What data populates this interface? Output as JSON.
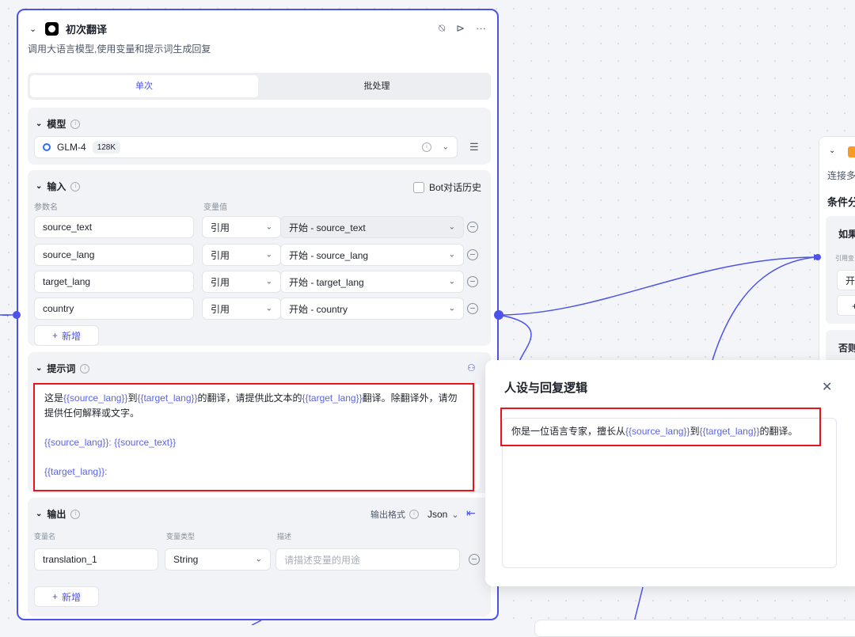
{
  "node": {
    "title": "初次翻译",
    "description": "调用大语言模型,使用变量和提示词生成回复",
    "tabs": {
      "single": "单次",
      "batch": "批处理"
    },
    "model": {
      "section_label": "模型",
      "name": "GLM-4",
      "context_badge": "128K"
    },
    "input": {
      "section_label": "输入",
      "bot_history_label": "Bot对话历史",
      "param_name_header": "参数名",
      "var_value_header": "变量值",
      "rows": [
        {
          "name": "source_text",
          "mode": "引用",
          "value": "开始 - source_text"
        },
        {
          "name": "source_lang",
          "mode": "引用",
          "value": "开始 - source_lang"
        },
        {
          "name": "target_lang",
          "mode": "引用",
          "value": "开始 - target_lang"
        },
        {
          "name": "country",
          "mode": "引用",
          "value": "开始 - country"
        }
      ],
      "add_label": "新增"
    },
    "prompt": {
      "section_label": "提示词",
      "line1_a": "这是",
      "line1_var1": "{{source_lang}}",
      "line1_b": "到",
      "line1_var2": "{{target_lang}}",
      "line1_c": "的翻译，请提供此文本的",
      "line1_var3": "{{target_lang}}",
      "line1_d": "翻译。除翻译外，请勿",
      "line2": "提供任何解释或文字。",
      "line3_var1": "{{source_lang}}",
      "line3_sep": ": ",
      "line3_var2": "{{source_text}}",
      "line4_var": "{{target_lang}}",
      "line4_sep": ":"
    },
    "output": {
      "section_label": "输出",
      "format_label": "输出格式",
      "format_value": "Json",
      "var_name_header": "变量名",
      "var_type_header": "变量类型",
      "desc_header": "描述",
      "row": {
        "name": "translation_1",
        "type": "String",
        "desc_placeholder": "请描述变量的用途"
      },
      "add_label": "新增"
    }
  },
  "right_node": {
    "desc_fragment": "连接多",
    "condition_title": "条件分",
    "if_label": "如果",
    "ref_label": "引用变",
    "start_fragment": "开",
    "else_label": "否则"
  },
  "popup": {
    "title": "人设与回复逻辑",
    "text_a": "你是一位语言专家，擅长从",
    "text_var1": "{{source_lang}}",
    "text_b": "到",
    "text_var2": "{{target_lang}}",
    "text_c": "的翻译。"
  },
  "colors": {
    "accent": "#4d53e8",
    "highlight": "#e8141c",
    "variable": "#5b63e6"
  }
}
